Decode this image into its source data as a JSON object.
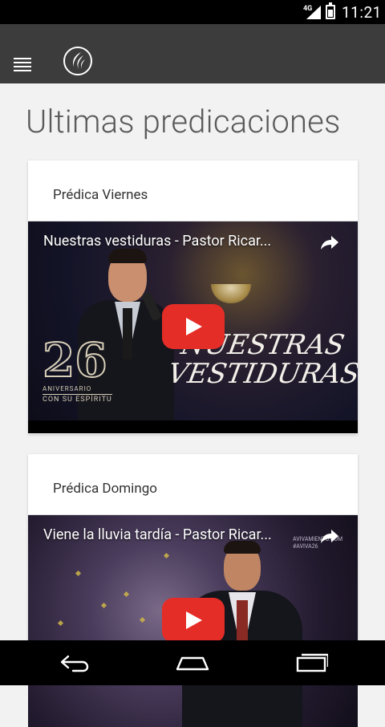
{
  "status_bar": {
    "network": "4G",
    "time": "11:21"
  },
  "app_bar": {
    "menu_icon": "menu-icon",
    "logo_icon": "flame-logo"
  },
  "page": {
    "title": "Ultimas predicaciones"
  },
  "cards": [
    {
      "title": "Prédica Viernes",
      "video": {
        "title": "Nuestras vestiduras - Pastor Ricar...",
        "overlay_line1": "NUESTRAS",
        "overlay_line2": "VESTIDURAS",
        "badge_number": "26",
        "badge_sub1": "ANIVERSARIO",
        "badge_sub2": "CON SU ESPÍRITU"
      }
    },
    {
      "title": "Prédica Domingo",
      "video": {
        "title": "Viene la lluvia tardía - Pastor Ricar...",
        "watermark_line1": "AVIVAMIENTO.COM",
        "watermark_line2": "#AVIVA26"
      }
    }
  ],
  "nav_bar": {
    "back_icon": "back-icon",
    "home_icon": "home-icon",
    "recents_icon": "recents-icon"
  }
}
